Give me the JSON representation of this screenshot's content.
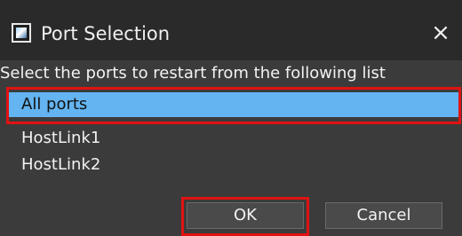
{
  "window": {
    "title": "Port Selection",
    "close_label": "×"
  },
  "instruction": "Select the ports to restart from the following list",
  "ports": [
    {
      "label": "All ports",
      "selected": true
    },
    {
      "label": "HostLink1",
      "selected": false
    },
    {
      "label": "HostLink2",
      "selected": false
    }
  ],
  "buttons": {
    "ok_label": "OK",
    "cancel_label": "Cancel"
  },
  "colors": {
    "selection": "#63b4f0",
    "highlight_frame": "#e01212"
  }
}
